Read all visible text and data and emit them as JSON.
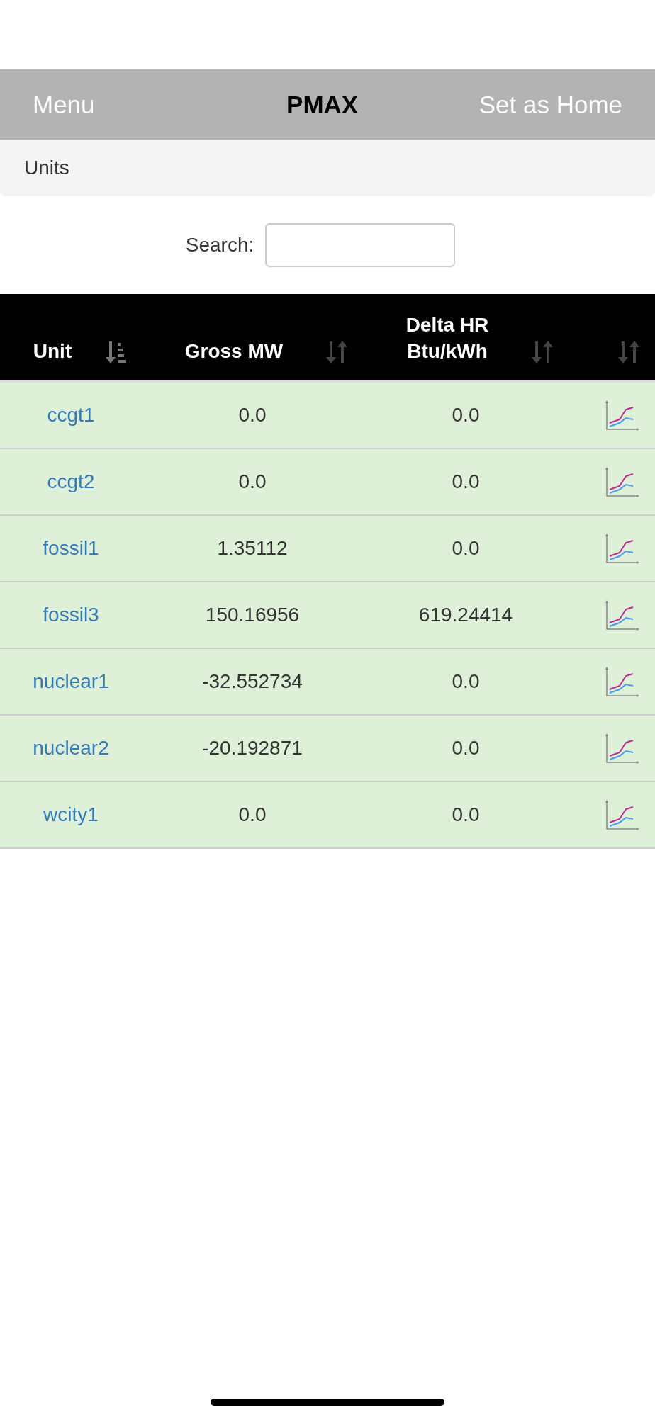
{
  "navbar": {
    "menu": "Menu",
    "title": "PMAX",
    "home_action": "Set as Home"
  },
  "breadcrumb": "Units",
  "search": {
    "label": "Search:"
  },
  "table": {
    "columns": [
      {
        "label": "Unit",
        "sorted": true
      },
      {
        "label": "Gross MW",
        "sorted": false
      },
      {
        "label": "Delta HR Btu/kWh",
        "sorted": false
      },
      {
        "sorted": false
      }
    ],
    "rows": [
      {
        "unit": "ccgt1",
        "gross_mw": "0.0",
        "delta_hr": "0.0"
      },
      {
        "unit": "ccgt2",
        "gross_mw": "0.0",
        "delta_hr": "0.0"
      },
      {
        "unit": "fossil1",
        "gross_mw": "1.35112",
        "delta_hr": "0.0"
      },
      {
        "unit": "fossil3",
        "gross_mw": "150.16956",
        "delta_hr": "619.24414"
      },
      {
        "unit": "nuclear1",
        "gross_mw": "-32.552734",
        "delta_hr": "0.0"
      },
      {
        "unit": "nuclear2",
        "gross_mw": "-20.192871",
        "delta_hr": "0.0"
      },
      {
        "unit": "wcity1",
        "gross_mw": "0.0",
        "delta_hr": "0.0"
      }
    ]
  }
}
